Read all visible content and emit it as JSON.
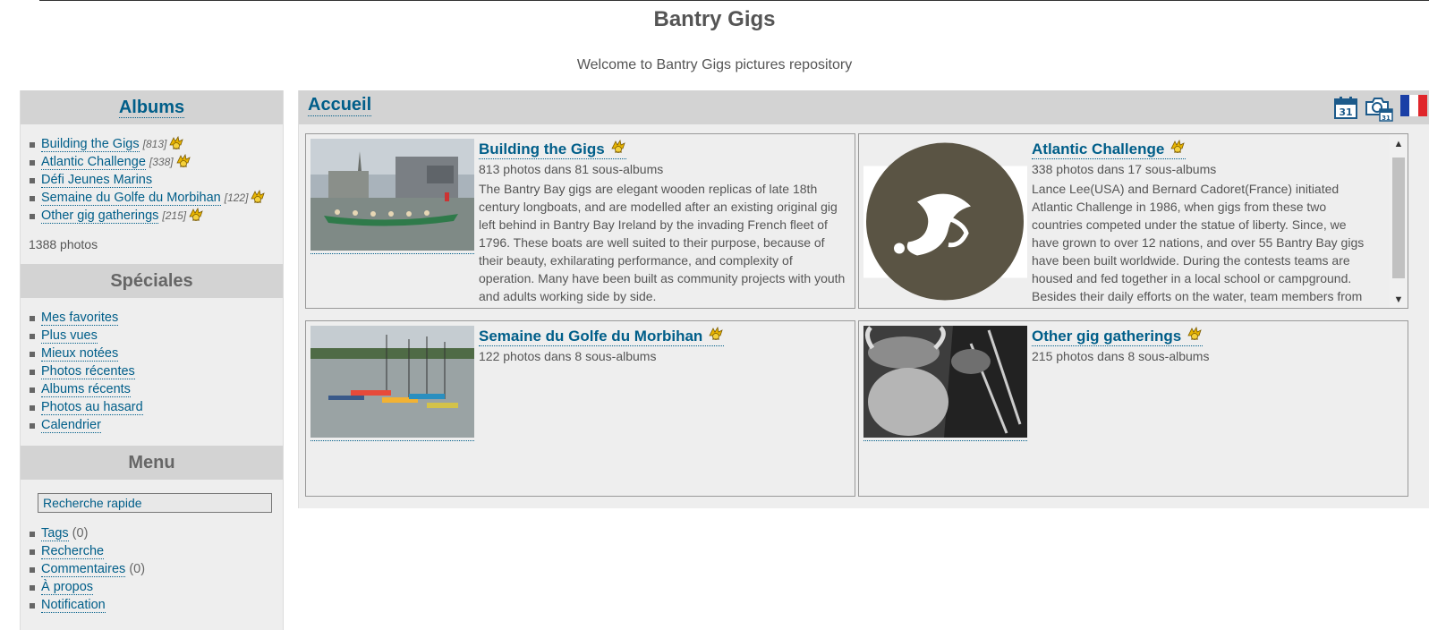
{
  "header": {
    "title": "Bantry Gigs",
    "subtitle": "Welcome to Bantry Gigs pictures repository"
  },
  "sidebar": {
    "albums_title": "Albums",
    "albums": [
      {
        "label": "Building the Gigs",
        "count": "[813]"
      },
      {
        "label": "Atlantic Challenge",
        "count": "[338]"
      },
      {
        "label": "Défi Jeunes Marins",
        "count": ""
      },
      {
        "label": "Semaine du Golfe du Morbihan",
        "count": "[122]"
      },
      {
        "label": "Other gig gatherings",
        "count": "[215]"
      }
    ],
    "total_photos": "1388 photos",
    "specials_title": "Spéciales",
    "specials": [
      "Mes favorites",
      "Plus vues",
      "Mieux notées",
      "Photos récentes",
      "Albums récents",
      "Photos au hasard",
      "Calendrier"
    ],
    "menu_title": "Menu",
    "search_value": "Recherche rapide",
    "menu": [
      {
        "label": "Tags",
        "extra": "(0)"
      },
      {
        "label": "Recherche",
        "extra": ""
      },
      {
        "label": "Commentaires",
        "extra": "(0)"
      },
      {
        "label": "À propos",
        "extra": ""
      },
      {
        "label": "Notification",
        "extra": ""
      }
    ]
  },
  "content": {
    "breadcrumb": "Accueil",
    "toolbar_icons": [
      "calendar-icon",
      "camera-calendar-icon",
      "french-flag-icon"
    ],
    "calendar_day": "31",
    "albums": [
      {
        "name": "Building the Gigs",
        "count": "813 photos dans 81 sous-albums",
        "desc": "The Bantry Bay gigs are elegant wooden replicas of late 18th century longboats, and are modelled after an existing original gig left behind in Bantry Bay Ireland by the invading French fleet of 1796. These boats are well suited to their purpose, because of their beauty, exhilarating performance, and complexity of operation. Many have been built as community projects with youth and adults working side by side."
      },
      {
        "name": "Atlantic Challenge",
        "count": "338 photos dans 17 sous-albums",
        "desc": "Lance Lee(USA) and Bernard Cadoret(France) initiated Atlantic Challenge in 1986, when gigs from these two countries competed under the statue of liberty. Since, we have grown to over 12 nations, and over 55 Bantry Bay gigs have been built worldwide. During the contests teams are housed and fed together in a local school or campground. Besides their daily efforts on the water, team members from different countries have ample time to spend together, and"
      },
      {
        "name": "Semaine du Golfe du Morbihan",
        "count": "122 photos dans 8 sous-albums",
        "desc": ""
      },
      {
        "name": "Other gig gatherings",
        "count": "215 photos dans 8 sous-albums",
        "desc": ""
      }
    ]
  },
  "colors": {
    "link": "#005e89",
    "panel": "#eeeeee",
    "title_bar": "#d3d3d3"
  }
}
